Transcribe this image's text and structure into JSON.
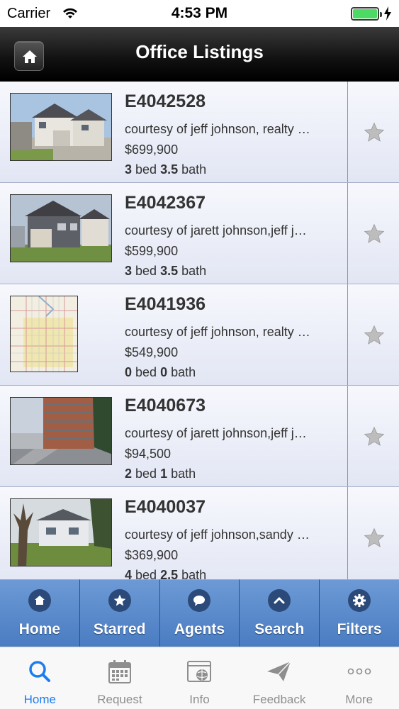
{
  "status_bar": {
    "carrier": "Carrier",
    "time": "4:53 PM"
  },
  "header": {
    "title": "Office Listings"
  },
  "listings": [
    {
      "id": "E4042528",
      "courtesy": "courtesy of jeff johnson, realty …",
      "price": "$699,900",
      "beds": "3",
      "bed_label": "bed",
      "baths": "3.5",
      "bath_label": "bath"
    },
    {
      "id": "E4042367",
      "courtesy": "courtesy of jarett johnson,jeff j…",
      "price": "$599,900",
      "beds": "3",
      "bed_label": "bed",
      "baths": "3.5",
      "bath_label": "bath"
    },
    {
      "id": "E4041936",
      "courtesy": "courtesy of jeff johnson, realty …",
      "price": "$549,900",
      "beds": "0",
      "bed_label": "bed",
      "baths": "0",
      "bath_label": "bath"
    },
    {
      "id": "E4040673",
      "courtesy": "courtesy of jarett johnson,jeff j…",
      "price": "$94,500",
      "beds": "2",
      "bed_label": "bed",
      "baths": "1",
      "bath_label": "bath"
    },
    {
      "id": "E4040037",
      "courtesy": "courtesy of jeff johnson,sandy …",
      "price": "$369,900",
      "beds": "4",
      "bed_label": "bed",
      "baths": "2.5",
      "bath_label": "bath"
    }
  ],
  "action_bar": [
    {
      "label": "Home",
      "icon": "house-icon"
    },
    {
      "label": "Starred",
      "icon": "star-icon"
    },
    {
      "label": "Agents",
      "icon": "chat-bubble-icon"
    },
    {
      "label": "Search",
      "icon": "chevron-up-icon"
    },
    {
      "label": "Filters",
      "icon": "gear-icon"
    }
  ],
  "tab_bar": [
    {
      "label": "Home",
      "icon": "search-icon",
      "active": true
    },
    {
      "label": "Request",
      "icon": "calendar-icon",
      "active": false
    },
    {
      "label": "Info",
      "icon": "browser-globe-icon",
      "active": false
    },
    {
      "label": "Feedback",
      "icon": "paper-plane-icon",
      "active": false
    },
    {
      "label": "More",
      "icon": "more-dots-icon",
      "active": false
    }
  ],
  "colors": {
    "accent": "#1b7cf2",
    "action_bar": "#5a8ccc",
    "battery": "#4cd964"
  }
}
